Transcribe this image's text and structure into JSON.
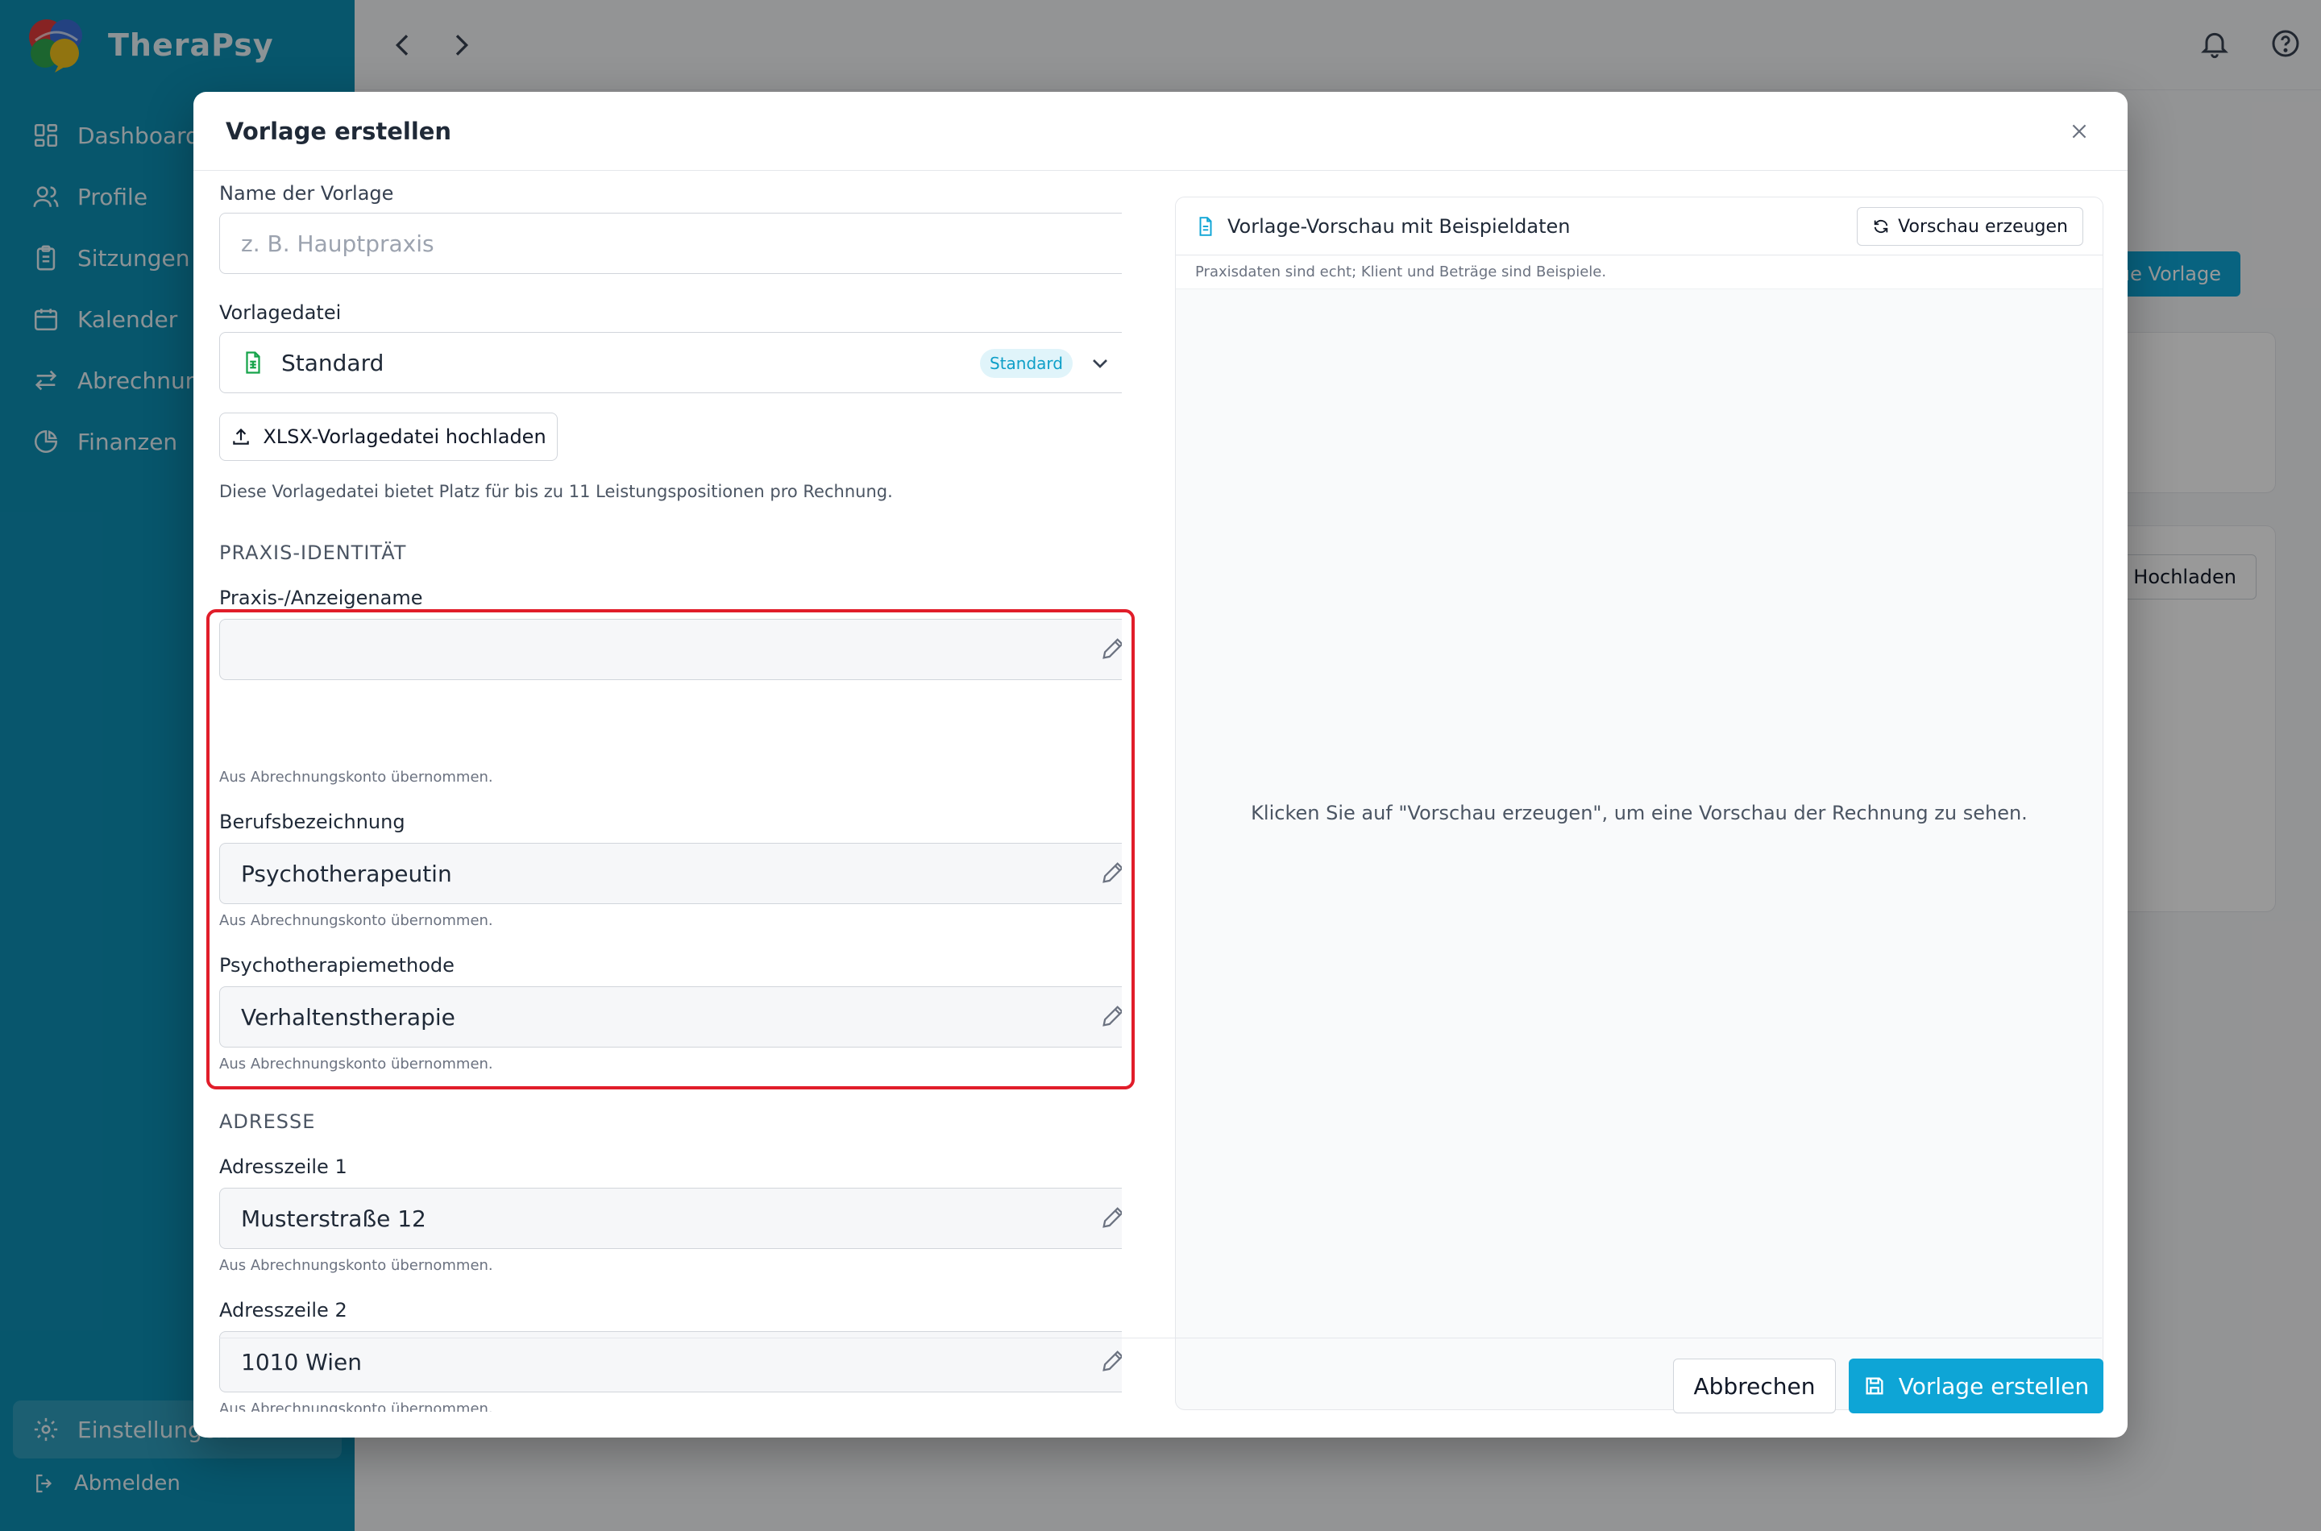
{
  "app": {
    "name": "TheraPsy"
  },
  "sidebar": {
    "items": [
      {
        "label": "Dashboard",
        "icon": "dashboard-icon"
      },
      {
        "label": "Profile",
        "icon": "users-icon"
      },
      {
        "label": "Sitzungen",
        "icon": "clipboard-icon"
      },
      {
        "label": "Kalender",
        "icon": "calendar-icon"
      },
      {
        "label": "Abrechnungen",
        "icon": "exchange-icon"
      },
      {
        "label": "Finanzen",
        "icon": "pie-chart-icon"
      }
    ],
    "settings_label": "Einstellungen",
    "logout_label": "Abmelden"
  },
  "background": {
    "new_template_btn": "Neue Vorlage",
    "upload_btn": "Hochladen"
  },
  "modal": {
    "title": "Vorlage erstellen",
    "name_label": "Name der Vorlage",
    "name_placeholder": "z. B. Hauptpraxis",
    "template_file_label": "Vorlagedatei",
    "template_file_value": "Standard",
    "template_file_badge": "Standard",
    "upload_label": "XLSX-Vorlagedatei hochladen",
    "capacity_hint": "Diese Vorlagedatei bietet Platz für bis zu 11 Leistungspositionen pro Rechnung.",
    "section_identity": "PRAXIS-IDENTITÄT",
    "display_name_label": "Praxis-/Anzeigename",
    "display_name_value": "",
    "account_hint": "Aus Abrechnungskonto übernommen.",
    "profession_label": "Berufsbezeichnung",
    "profession_value": "Psychotherapeutin",
    "method_label": "Psychotherapiemethode",
    "method_value": "Verhaltenstherapie",
    "section_address": "ADRESSE",
    "address1_label": "Adresszeile 1",
    "address1_value": "Musterstraße 12",
    "address2_label": "Adresszeile 2",
    "address2_value": "1010 Wien",
    "preview": {
      "title": "Vorlage-Vorschau mit Beispieldaten",
      "button": "Vorschau erzeugen",
      "subtitle": "Praxisdaten sind echt; Klient und Beträge sind Beispiele.",
      "empty_text": "Klicken Sie auf \"Vorschau erzeugen\", um eine Vorschau der Rechnung zu sehen."
    },
    "cancel_label": "Abbrechen",
    "submit_label": "Vorlage erstellen"
  },
  "colors": {
    "primary": "#0ea5d6",
    "sidebar": "#0d8fb5",
    "highlight": "#e11d2a"
  }
}
